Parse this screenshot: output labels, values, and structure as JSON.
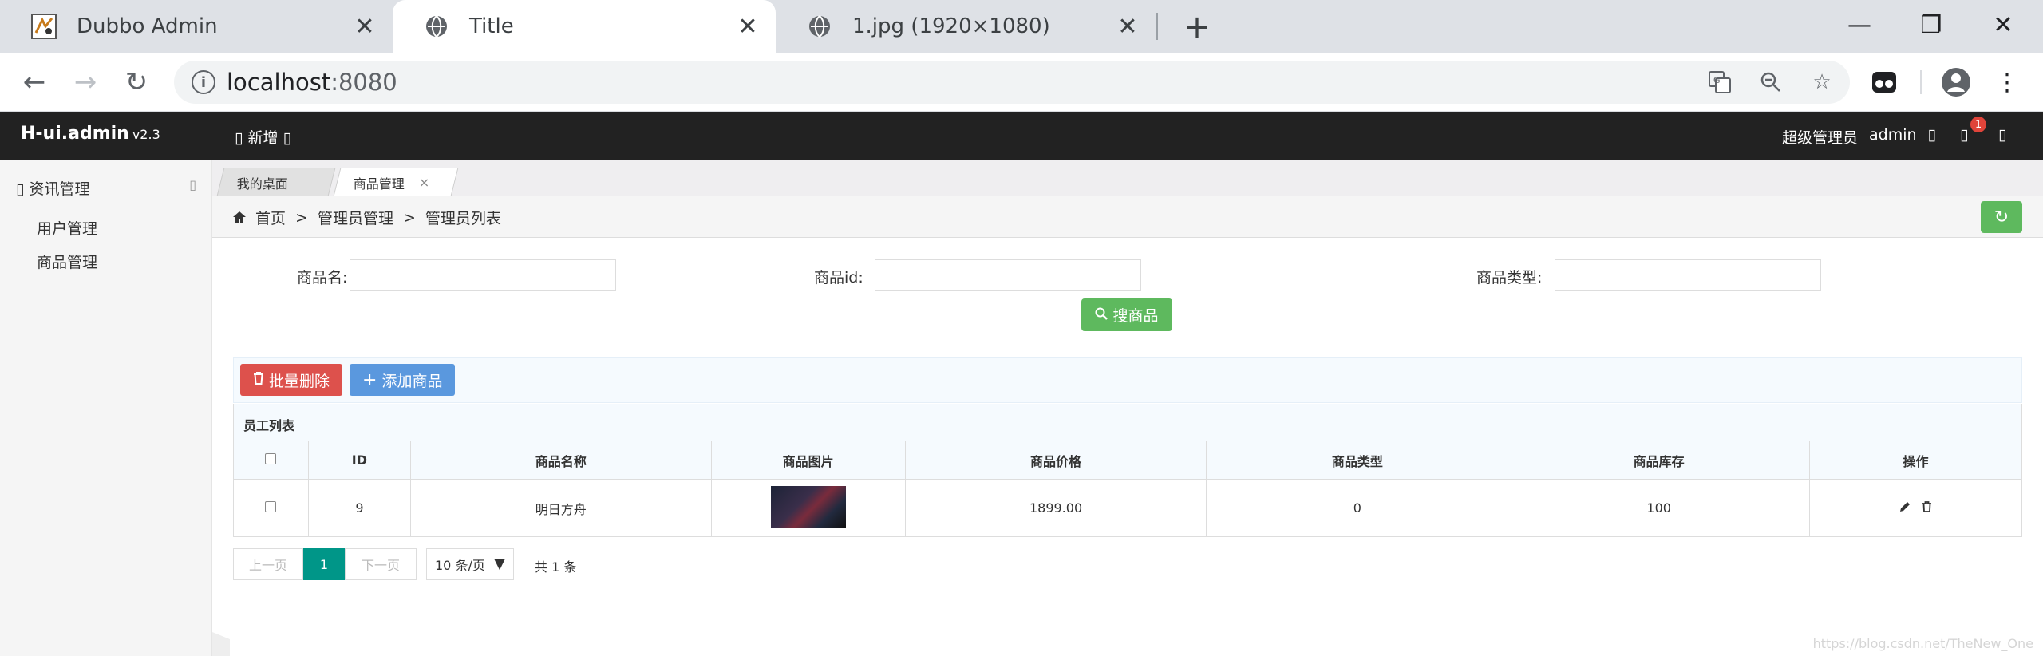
{
  "browser": {
    "tabs": [
      {
        "title": "Dubbo Admin"
      },
      {
        "title": "Title"
      },
      {
        "title": "1.jpg (1920×1080)"
      }
    ],
    "url_host": "localhost",
    "url_port": ":8080"
  },
  "header": {
    "logo": "H-ui.admin",
    "version": "v2.3",
    "new_btn": "新增",
    "role": "超级管理员",
    "user": "admin",
    "badge": "1"
  },
  "sidebar": {
    "group": "资讯管理",
    "items": [
      {
        "label": "用户管理"
      },
      {
        "label": "商品管理"
      }
    ]
  },
  "page_tabs": [
    {
      "label": "我的桌面"
    },
    {
      "label": "商品管理"
    }
  ],
  "breadcrumb": {
    "home": "首页",
    "sep": ">",
    "level1": "管理员管理",
    "level2": "管理员列表"
  },
  "search": {
    "name_label": "商品名:",
    "id_label": "商品id:",
    "type_label": "商品类型:",
    "button": "搜商品"
  },
  "toolbar": {
    "batch_delete": "批量删除",
    "add": "添加商品"
  },
  "table": {
    "caption": "员工列表",
    "headers": [
      "ID",
      "商品名称",
      "商品图片",
      "商品价格",
      "商品类型",
      "商品库存",
      "操作"
    ],
    "rows": [
      {
        "id": "9",
        "name": "明日方舟",
        "price": "1899.00",
        "type": "0",
        "stock": "100"
      }
    ]
  },
  "pagination": {
    "prev": "上一页",
    "current": "1",
    "next": "下一页",
    "page_size": "10 条/页",
    "total": "共 1 条"
  },
  "watermark": "https://blog.csdn.net/TheNew_One"
}
